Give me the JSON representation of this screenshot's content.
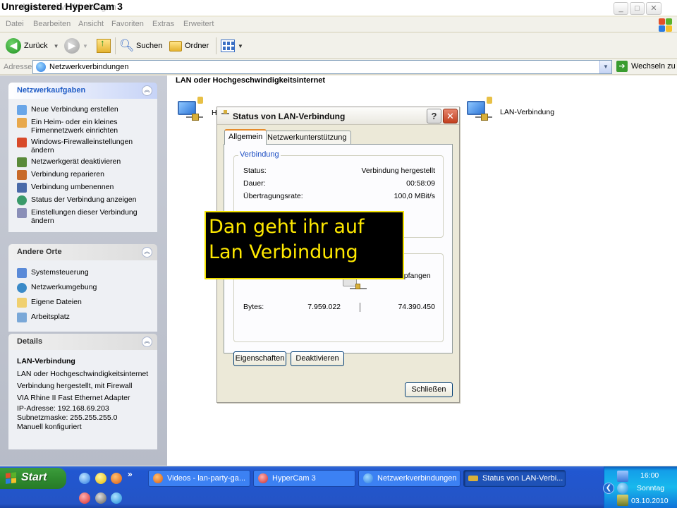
{
  "window": {
    "ghost_title": "Netzwerkverbindungen",
    "watermark": "Unregistered HyperCam 3",
    "buttons": [
      "_",
      "□",
      "✕"
    ]
  },
  "menu": [
    "Datei",
    "Bearbeiten",
    "Ansicht",
    "Favoriten",
    "Extras",
    "Erweitert"
  ],
  "toolbar": {
    "back": "Zurück",
    "search": "Suchen",
    "folders": "Ordner"
  },
  "address": {
    "label": "Adresse",
    "value": "Netzwerkverbindungen",
    "go": "Wechseln zu"
  },
  "sidebar": {
    "network_tasks": {
      "title": "Netzwerkaufgaben",
      "items": [
        "Neue Verbindung erstellen",
        "Ein Heim- oder ein kleines Firmennetzwerk einrichten",
        "Windows-Firewalleinstellungen ändern",
        "Netzwerkgerät deaktivieren",
        "Verbindung reparieren",
        "Verbindung umbenennen",
        "Status der Verbindung anzeigen",
        "Einstellungen dieser Verbindung ändern"
      ]
    },
    "other_places": {
      "title": "Andere Orte",
      "items": [
        "Systemsteuerung",
        "Netzwerkumgebung",
        "Eigene Dateien",
        "Arbeitsplatz"
      ]
    },
    "details": {
      "title": "Details",
      "name": "LAN-Verbindung",
      "lines": [
        "LAN oder Hochgeschwindigkeitsinternet",
        "Verbindung hergestellt, mit Firewall",
        "VIA Rhine II Fast Ethernet Adapter",
        "IP-Adresse: 192.168.69.203",
        "Subnetzmaske: 255.255.255.0",
        "Manuell konfiguriert"
      ]
    }
  },
  "content": {
    "group_header": "LAN oder Hochgeschwindigkeitsinternet",
    "partial_label": "H",
    "connection_label": "LAN-Verbindung"
  },
  "dialog": {
    "title": "Status von LAN-Verbindung",
    "help": "?",
    "close": "✕",
    "tabs": [
      "Allgemein",
      "Netzwerkunterstützung"
    ],
    "connection": {
      "legend": "Verbindung",
      "status_label": "Status:",
      "status_value": "Verbindung hergestellt",
      "duration_label": "Dauer:",
      "duration_value": "00:58:09",
      "speed_label": "Übertragungsrate:",
      "speed_value": "100,0 MBit/s"
    },
    "activity": {
      "received_partial": "mpfangen",
      "bytes_label": "Bytes:",
      "sent": "7.959.022",
      "received": "74.390.450"
    },
    "buttons": {
      "properties": "Eigenschaften",
      "disable": "Deaktivieren",
      "close": "Schließen"
    }
  },
  "caption": {
    "line1": "Dan geht ihr auf",
    "line2": "Lan Verbindung"
  },
  "taskbar": {
    "start": "Start",
    "chevron": "»",
    "tasks": [
      "Videos - lan-party-ga...",
      "HyperCam 3",
      "Netzwerkverbindungen",
      "Status von LAN-Verbi..."
    ],
    "clock": {
      "time": "16:00",
      "day": "Sonntag",
      "date": "03.10.2010"
    }
  },
  "colors": {
    "xp_blue": "#2157d1",
    "start_green": "#2f8b2f",
    "caption_yellow": "#ffe900",
    "link_blue": "#215dc6"
  }
}
